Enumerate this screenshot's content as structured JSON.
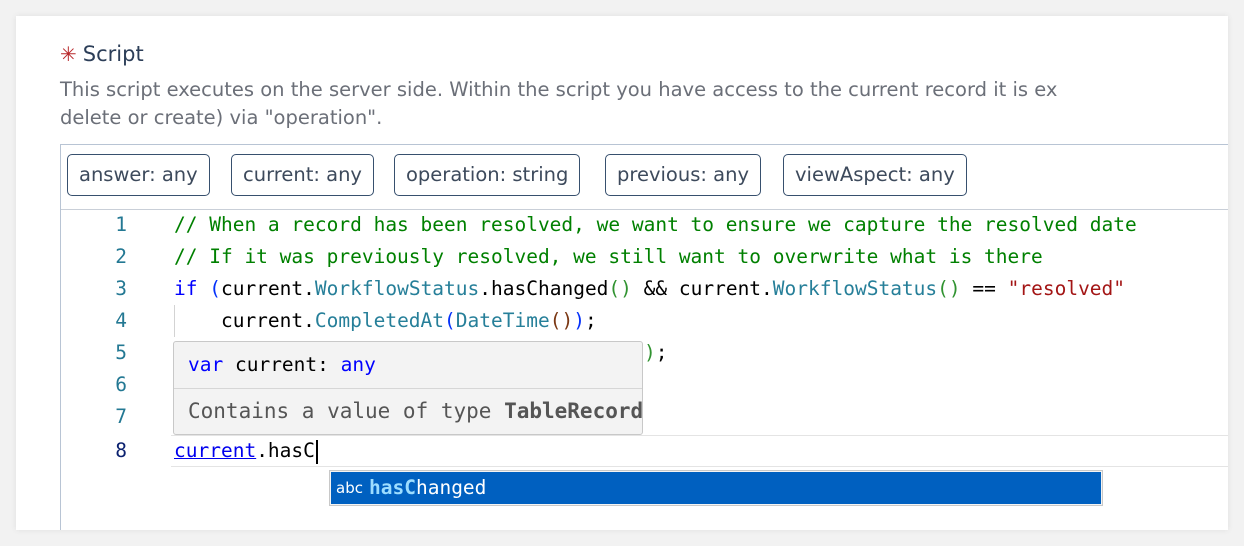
{
  "field": {
    "required_marker": "✳",
    "label": "Script",
    "description_line1": "This script executes on the server side. Within the script you have access to the current record it is ex",
    "description_line2": "delete or create) via \"operation\"."
  },
  "chips": [
    "answer: any",
    "current: any",
    "operation: string",
    "previous: any",
    "viewAspect: any"
  ],
  "editor": {
    "line_numbers": [
      "1",
      "2",
      "3",
      "4",
      "5",
      "6",
      "7",
      "8"
    ],
    "active_line": "8",
    "line1": "// When a record has been resolved, we want to ensure we capture the resolved date",
    "line2": "// If it was previously resolved, we still want to overwrite what is there",
    "line3": {
      "kw": "if",
      "t1": " ",
      "p1": "(",
      "t2": "current.",
      "f1": "WorkflowStatus",
      "t3": ".hasChanged",
      "p2": "()",
      "t4": " && current.",
      "f2": "WorkflowStatus",
      "p3": "()",
      "t5": " == ",
      "str": "\"resolved\""
    },
    "line4": {
      "t1": "    current.",
      "f1": "CompletedAt",
      "p1": "(",
      "f2": "DateTime",
      "p2": "()",
      "p3": ")",
      "t2": ";"
    },
    "line5_tail_paren": ")",
    "line5_tail": ";",
    "line8": {
      "word": "current",
      "rest": ".hasC"
    }
  },
  "hover": {
    "kw": "var",
    "name": " current: ",
    "type": "any",
    "doc_prefix": "Contains a value of type ",
    "doc_type": "TableRecord"
  },
  "suggest": {
    "kind": "abc",
    "match": "hasC",
    "rest": "hanged"
  },
  "colors": {
    "comment": "#008000",
    "keyword": "#0000ff",
    "function": "#267f99",
    "string": "#a31515",
    "selection": "#0060c0"
  }
}
